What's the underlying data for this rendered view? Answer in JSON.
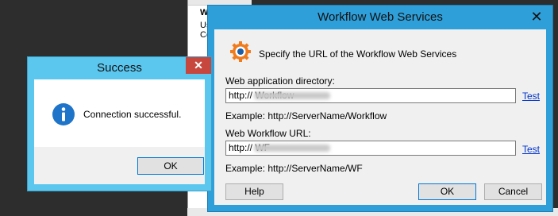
{
  "background_window": {
    "title_fragment": "W",
    "line1_fragment": "Us",
    "line2_fragment": "Co"
  },
  "workflow_dialog": {
    "title": "Workflow Web Services",
    "close_glyph": "✕",
    "heading": "Specify the URL of the Workflow Web Services",
    "web_app_dir": {
      "label": "Web application directory:",
      "value": "http://                                Workflow",
      "test_label": "Test",
      "example": "Example: http://ServerName/Workflow"
    },
    "web_workflow_url": {
      "label": "Web Workflow URL:",
      "value": "http://                                WF",
      "test_label": "Test",
      "example": "Example: http://ServerName/WF"
    },
    "help_label": "Help",
    "ok_label": "OK",
    "cancel_label": "Cancel",
    "colors": {
      "frame": "#2f9fd9",
      "link": "#0033cc",
      "icon_ring": "#f07b1d",
      "icon_center": "#1c5fa8"
    }
  },
  "success_dialog": {
    "title": "Success",
    "close_glyph": "✕",
    "message": "Connection successful.",
    "ok_label": "OK",
    "colors": {
      "frame": "#5bc7ef",
      "close": "#c7473e",
      "info_icon": "#1e74c8"
    }
  }
}
